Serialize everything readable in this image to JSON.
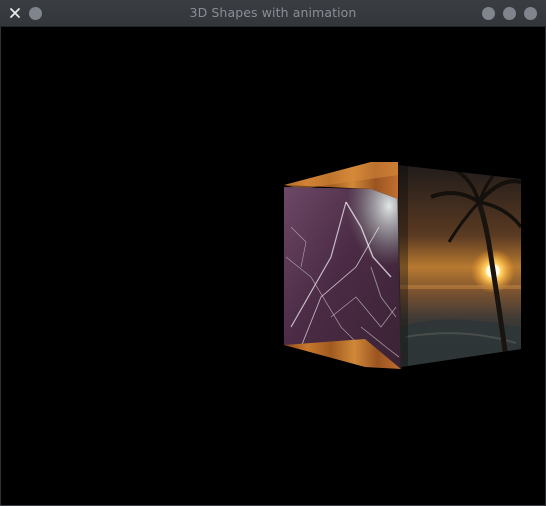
{
  "window": {
    "title": "3D Shapes with animation",
    "close_glyph": "×",
    "titlebar_bg": "#35383d",
    "title_color": "#8a8e96",
    "button_color": "#80848c"
  },
  "scene": {
    "background": "#000000",
    "object": "textured-cube",
    "faces": [
      {
        "name": "marble-face",
        "texture": "purple marble with white veins"
      },
      {
        "name": "sunset-face",
        "texture": "tropical beach sunset with palm tree"
      },
      {
        "name": "wood-face",
        "texture": "orange wood grain"
      }
    ]
  }
}
